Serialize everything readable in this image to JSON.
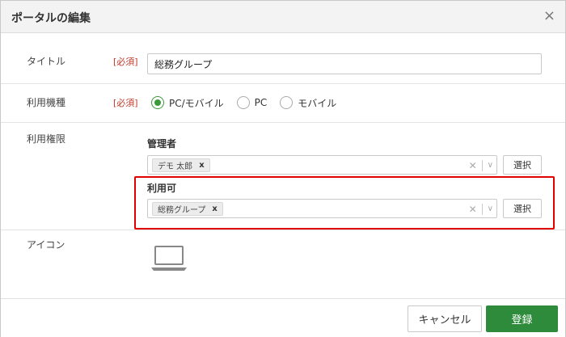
{
  "dialog": {
    "title": "ポータルの編集",
    "close_label": "×"
  },
  "form": {
    "title_field": {
      "label": "タイトル",
      "required": "[必須]",
      "value": "総務グループ"
    },
    "device_field": {
      "label": "利用機種",
      "required": "[必須]",
      "options": [
        {
          "label": "PC/モバイル",
          "checked": true
        },
        {
          "label": "PC",
          "checked": false
        },
        {
          "label": "モバイル",
          "checked": false
        }
      ]
    },
    "permission_field": {
      "label": "利用権限",
      "admin": {
        "heading": "管理者",
        "tags": [
          "デモ 太郎"
        ],
        "select_button": "選択"
      },
      "usable": {
        "heading": "利用可",
        "tags": [
          "総務グループ"
        ],
        "select_button": "選択"
      }
    },
    "icon_field": {
      "label": "アイコン",
      "icon": "laptop-icon"
    }
  },
  "footer": {
    "cancel_label": "キャンセル",
    "submit_label": "登録"
  },
  "colors": {
    "accent_green": "#2e8b3b",
    "required_red": "#c0392b",
    "highlight_red": "#e00000"
  }
}
